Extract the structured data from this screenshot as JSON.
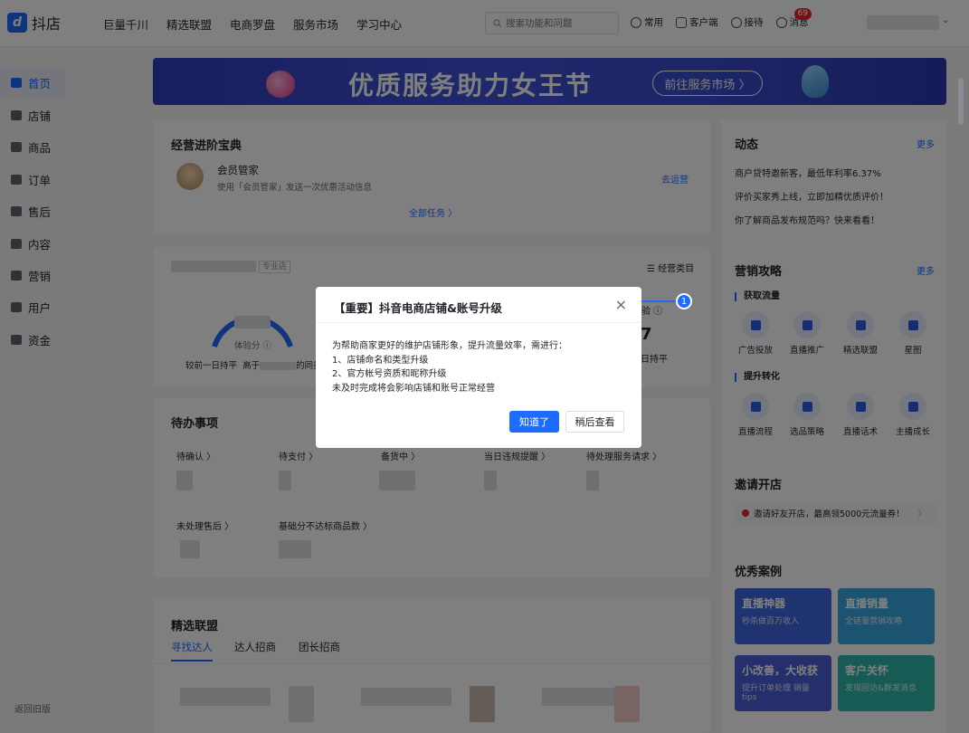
{
  "app": {
    "logo_mark": "d",
    "logo_text": "抖店"
  },
  "top_nav": [
    "巨量千川",
    "精选联盟",
    "电商罗盘",
    "服务市场",
    "学习中心"
  ],
  "search": {
    "placeholder": "搜索功能和问题"
  },
  "top_tools": {
    "common": "常用",
    "client": "客户端",
    "reception": "接待",
    "messages": "消息",
    "message_count": "69"
  },
  "sidebar": {
    "items": [
      {
        "label": "首页",
        "active": true
      },
      {
        "label": "店铺"
      },
      {
        "label": "商品"
      },
      {
        "label": "订单"
      },
      {
        "label": "售后"
      },
      {
        "label": "内容"
      },
      {
        "label": "营销"
      },
      {
        "label": "用户"
      },
      {
        "label": "资金"
      }
    ],
    "old_version": "返回旧版"
  },
  "banner": {
    "title": "优质服务助力女王节",
    "button": "前往服务市场 〉"
  },
  "growth": {
    "title": "经营进阶宝典",
    "task_name": "会员管家",
    "task_desc": "使用「会员管家」发送一次优惠活动信息",
    "task_action": "去运营",
    "all_tasks": "全部任务 〉"
  },
  "score": {
    "tag": "专业店",
    "category": "经营类目",
    "gauge_label": "体验分 ⓘ",
    "compare_left": "较前一日持平",
    "compare_mid": "高于",
    "compare_mid2": "的同类",
    "right_label": "验 ⓘ",
    "right_value": "7",
    "right_compare": "日持平"
  },
  "todo": {
    "title": "待办事项",
    "items": [
      "待确认 〉",
      "待支付 〉",
      "备货中 〉",
      "当日违规提醒 〉",
      "待处理服务请求 〉"
    ],
    "items2": [
      "未处理售后 〉",
      "基础分不达标商品数 〉"
    ]
  },
  "alliance": {
    "title": "精选联盟",
    "tabs": [
      "寻找达人",
      "达人招商",
      "团长招商"
    ]
  },
  "news": {
    "title": "动态",
    "more": "更多",
    "lines": [
      "商户贷特邀新客，最低年利率6.37%",
      "评价买家秀上线，立即加精优质评价！",
      "你了解商品发布规范吗？快来看看！"
    ]
  },
  "marketing": {
    "title": "营销攻略",
    "more": "更多",
    "group1": "获取流量",
    "tiles1": [
      "广告投放",
      "直播推广",
      "精选联盟",
      "星图"
    ],
    "group2": "提升转化",
    "tiles2": [
      "直播流程",
      "选品策略",
      "直播话术",
      "主播成长"
    ]
  },
  "invite": {
    "title": "邀请开店",
    "text": "邀请好友开店，最高领5000元流量券！",
    "arrow": "〉"
  },
  "cases": {
    "title": "优秀案例",
    "items": [
      {
        "title": "直播神器",
        "sub": "秒杀做百万收入",
        "color": "#3f66e0"
      },
      {
        "title": "直播销量",
        "sub": "全链量营销攻略",
        "color": "#37a6e0"
      },
      {
        "title": "小改善，大收获",
        "sub": "提升订单处理 销量tips",
        "color": "#4a5fd8"
      },
      {
        "title": "客户关怀",
        "sub": "发现回访&群发消息",
        "color": "#2fb7a8"
      }
    ]
  },
  "modal": {
    "title": "【重要】抖音电商店铺&账号升级",
    "close": "×",
    "body": [
      "为帮助商家更好的维护店铺形象，提升流量效率，需进行：",
      "1、店铺命名和类型升级",
      "2、官方帐号资质和昵称升级",
      "未及时完成将会影响店铺和账号正常经营"
    ],
    "confirm": "知道了",
    "later": "稍后查看"
  },
  "guide": {
    "step": "1"
  }
}
